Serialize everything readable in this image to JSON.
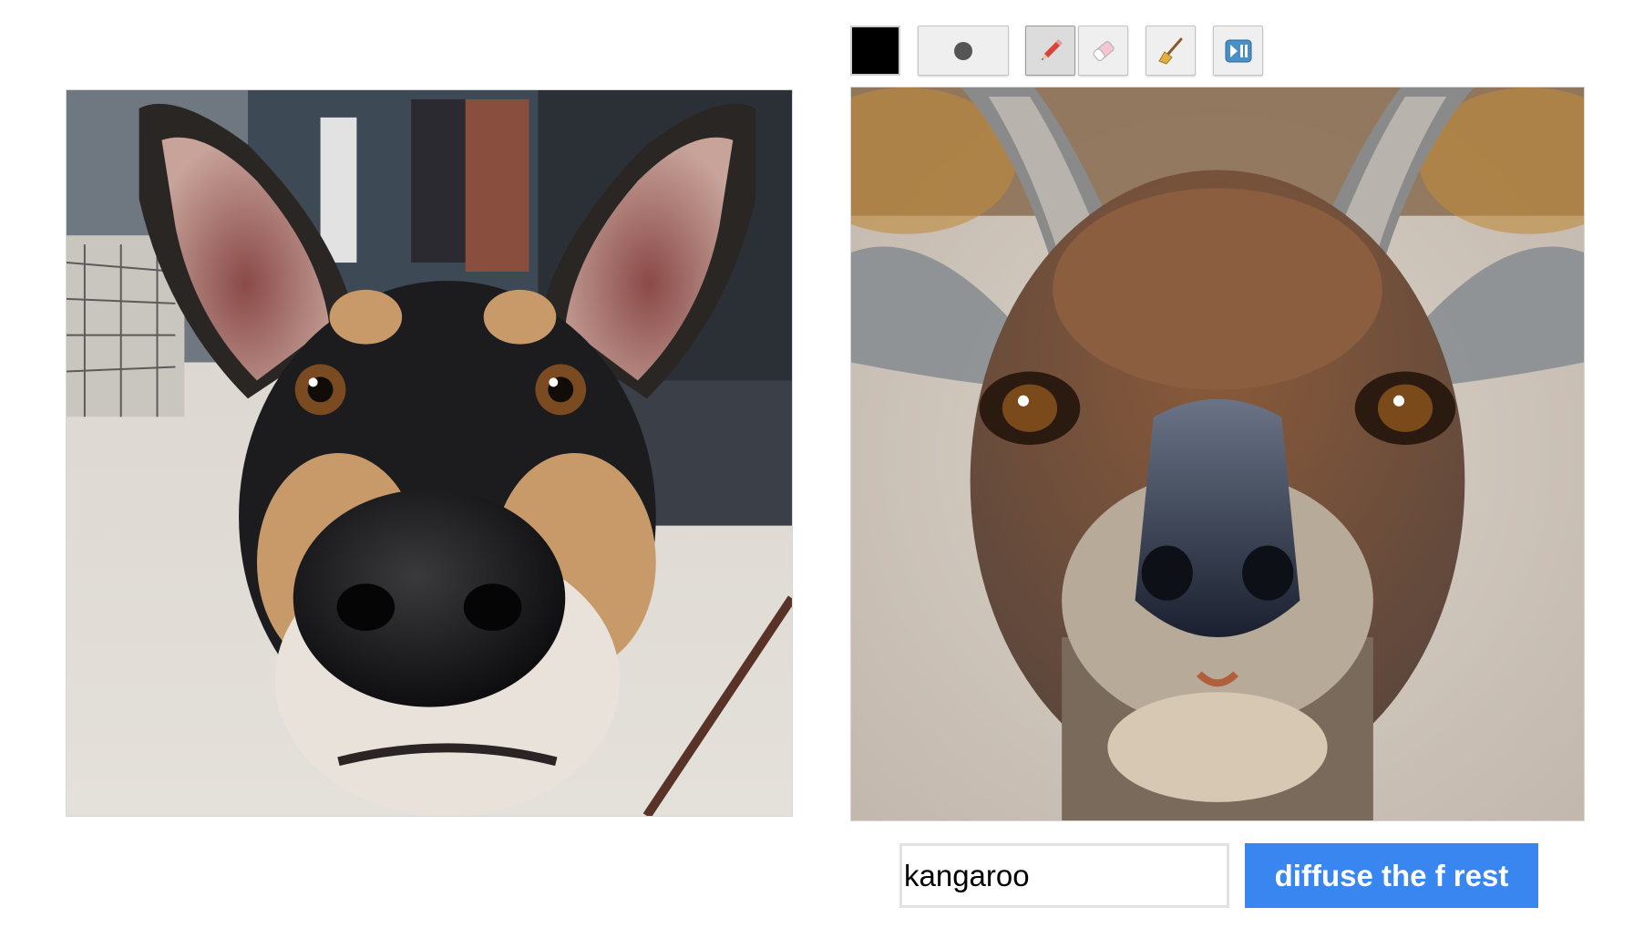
{
  "toolbar": {
    "color_swatch": {
      "color": "#000000"
    },
    "tools": [
      {
        "name": "brush-size",
        "icon": "dot-icon",
        "active": false
      },
      {
        "name": "pencil",
        "icon": "pencil-icon",
        "active": true
      },
      {
        "name": "eraser",
        "icon": "eraser-icon",
        "active": false
      },
      {
        "name": "clear",
        "icon": "broom-icon",
        "active": false
      },
      {
        "name": "play-pause",
        "icon": "play-pause-icon",
        "active": false
      }
    ]
  },
  "images": {
    "source": {
      "subject": "dog",
      "icon": "source-photo"
    },
    "output": {
      "subject": "kangaroo",
      "icon": "generated-image"
    }
  },
  "prompt": {
    "value": "kangaroo"
  },
  "actions": {
    "diffuse_label": "diffuse the f rest"
  },
  "colors": {
    "accent": "#3a86f0",
    "tool_bg": "#efefef",
    "swatch": "#000000"
  }
}
